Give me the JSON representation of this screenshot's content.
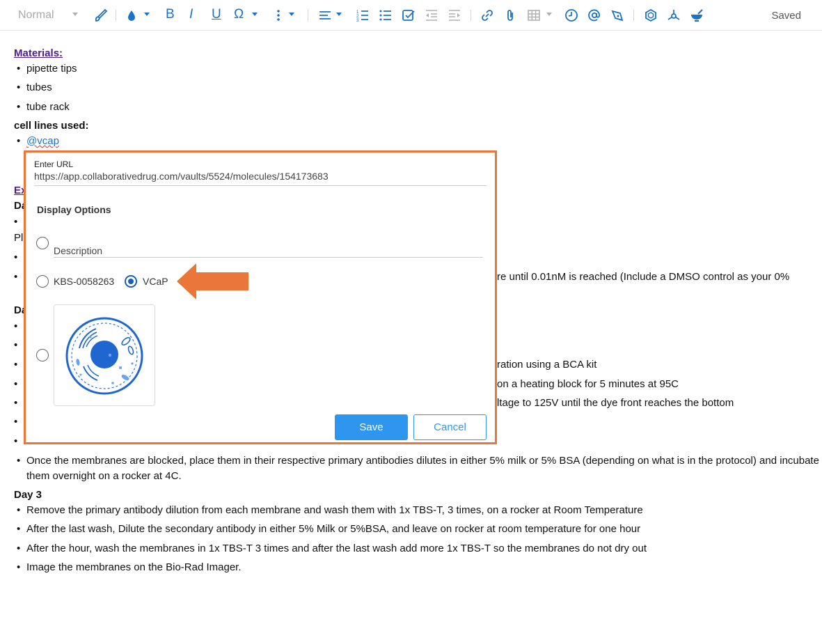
{
  "toolbar": {
    "style_select": "Normal",
    "bold": "B",
    "italic": "I",
    "underline": "U",
    "special_char": "Ω",
    "status": "Saved"
  },
  "document": {
    "materials_heading": "Materials:",
    "materials": [
      "pipette tips",
      "tubes",
      "tube rack"
    ],
    "cell_lines_heading": "cell lines used:",
    "cell_line_mention": "@vcap",
    "partial_heading": "Ex",
    "partial_day1": "Da",
    "partial_pl": "Pl",
    "partial_day2": "Da",
    "hidden_fragments": [
      "re until 0.01nM is reached (Include a DMSO control as your 0%",
      "ration using a BCA kit",
      "on a heating block for 5 minutes at 95C",
      "ltage to 125V until the dye front reaches the bottom"
    ],
    "primary_antibody_line1": "Once the membranes are blocked, place them in their respective primary antibodies dilutes in either 5% milk or 5% BSA (depending on what is in the protocol) and incubate",
    "primary_antibody_line2": "them overnight on a rocker at 4C.",
    "day3_heading": "Day 3",
    "day3_items": [
      "Remove the primary antibody dilution from each membrane and wash them with 1x TBS-T, 3 times, on a rocker at Room Temperature",
      "After the last wash, Dilute the secondary antibody in either 5% Milk or 5%BSA, and leave on rocker at room temperature for one hour",
      "After the hour, wash the membranes in 1x TBS-T 3 times and after the last wash add more 1x TBS-T so the membranes do not dry out",
      "Image the membranes on the Bio-Rad Imager."
    ]
  },
  "dialog": {
    "url_label": "Enter URL",
    "url_value": "https://app.collaborativedrug.com/vaults/5524/molecules/154173683",
    "display_options_title": "Display Options",
    "description_label": "Description",
    "option_kbs": "KBS-0058263",
    "option_vcap": "VCaP",
    "selected_option": "VCaP",
    "image_option_icon": "cell-image",
    "save_label": "Save",
    "cancel_label": "Cancel",
    "colors": {
      "highlight_border": "#ea7639",
      "arrow": "#ea7639",
      "primary": "#2f96ef",
      "icon_blue": "#1a73c8"
    }
  }
}
